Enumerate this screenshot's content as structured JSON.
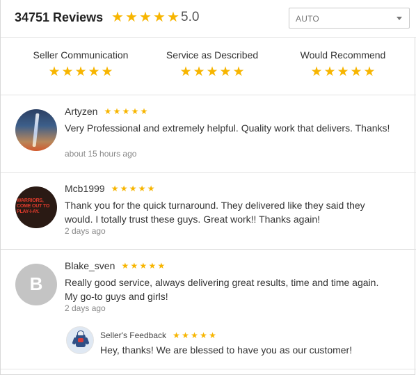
{
  "header": {
    "title": "34751 Reviews",
    "rating": "5.0",
    "star_count": 5,
    "sort_select": {
      "selected": "AUTO",
      "icon": "chevron-down-icon"
    }
  },
  "categories": [
    {
      "label": "Seller Communication",
      "stars": 5
    },
    {
      "label": "Service as Described",
      "stars": 5
    },
    {
      "label": "Would Recommend",
      "stars": 5
    }
  ],
  "reviews": [
    {
      "name": "Artyzen",
      "stars": 5,
      "text": "Very Professional and extremely helpful. Quality work that delivers. Thanks!",
      "time": "about 15 hours ago",
      "avatar": "lightning-photo"
    },
    {
      "name": "Mcb1999",
      "stars": 5,
      "text": "Thank you for the quick turnaround. They delivered like they said they would. I totally trust these guys. Great work!! Thanks again!",
      "time": "2 days ago",
      "avatar": "warriors-text-image",
      "avatar_text": "WARRIORS, COME OUT TO PLAY-I-AY."
    },
    {
      "name": "Blake_sven",
      "stars": 5,
      "text": "Really good service, always delivering great results, time and time again. My go-to guys and girls!",
      "time": "2 days ago",
      "avatar": "initial",
      "avatar_initial": "B",
      "seller_feedback": {
        "label": "Seller's Feedback",
        "stars": 5,
        "text": "Hey, thanks! We are blessed to have you as our customer!",
        "avatar": "robot-mascot"
      }
    }
  ],
  "colors": {
    "star": "#f7b500",
    "border": "#e3e3e3",
    "muted_text": "#888888"
  }
}
